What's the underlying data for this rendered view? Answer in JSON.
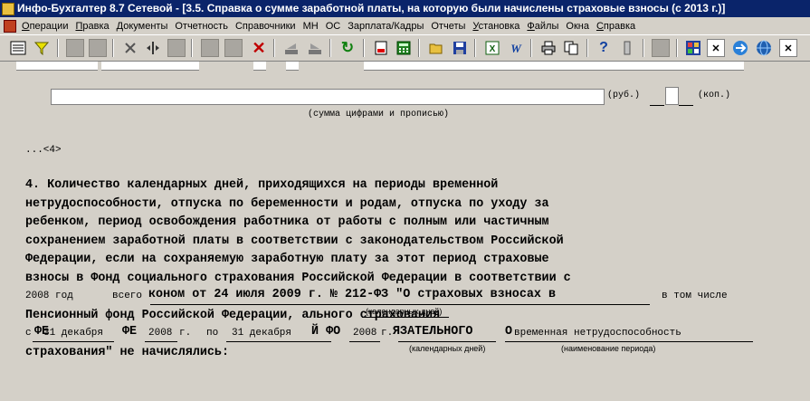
{
  "window": {
    "title": "Инфо-Бухгалтер 8.7 Сетевой - [3.5.  Справка о сумме заработной платы, на которую были начислены страховые взносы (с 2013 г.)]"
  },
  "menu": {
    "items": [
      {
        "hot": "О",
        "rest": "перации"
      },
      {
        "hot": "П",
        "rest": "равка"
      },
      {
        "hot": "Д",
        "rest": "окументы"
      },
      {
        "hot": "",
        "rest": "Отчетность"
      },
      {
        "hot": "",
        "rest": "Справочники"
      },
      {
        "hot": "",
        "rest": "МН"
      },
      {
        "hot": "",
        "rest": "ОС"
      },
      {
        "hot": "",
        "rest": "Зарплата/Кадры"
      },
      {
        "hot": "",
        "rest": "Отчеты"
      },
      {
        "hot": "У",
        "rest": "становка"
      },
      {
        "hot": "Ф",
        "rest": "айлы"
      },
      {
        "hot": "",
        "rest": "Окна"
      },
      {
        "hot": "С",
        "rest": "правка"
      }
    ]
  },
  "toolbar": {
    "icons": [
      "list-icon",
      "filter-icon",
      "blank-icon",
      "blank-icon",
      "cut-icon",
      "split-icon",
      "copy-icon",
      "blank-icon",
      "blank-icon",
      "delete-icon",
      "move-icon",
      "move-icon",
      "refresh-icon",
      "document-icon",
      "calculator-icon",
      "open-folder-icon",
      "save-icon",
      "excel-icon",
      "word-icon",
      "print-icon",
      "copy-icon",
      "help-icon",
      "info-icon",
      "blank-icon",
      "app-icon",
      "close-icon",
      "remote-icon",
      "globe-icon",
      "close-icon"
    ]
  },
  "form": {
    "rub_label": "(руб.)",
    "kop_label": "(коп.)",
    "sum_caption": "(сумма цифрами и прописью)",
    "note_ref": "...<4>",
    "paragraph_lines": [
      "4. Количество календарных дней, приходящихся на периоды временной",
      "нетрудоспособности, отпуска по беременности и родам, отпуска по уходу за",
      "ребенком, период освобождения работника от работы с полным или частичным",
      "сохранением заработной платы в соответствии с законодательством Российской",
      "Федерации, если на сохраняемую заработную плату за этот период страховые",
      "взносы в Фонд социального страхования Российской Федерации в соответствии с",
      "",
      "Пенсионный фонд Российской Федерации,       ального страхования",
      "",
      "страхования\" не начислялись:"
    ],
    "line7_bold": "коном от 24 июля 2009 г. № 212-ФЗ \"О страховых взносах в",
    "line7_year": "2008 год",
    "line7_total": "всего",
    "line7_including": "в том числе",
    "cal_days_1": "(календарных дней)",
    "line9_so": "с",
    "line9_from": "31 декабря",
    "line9_from_year": "2008",
    "line9_g": "г.",
    "line9_po": "по",
    "line9_to": "31 декабря",
    "line9_to_year": "2008",
    "line9_g2": "г.",
    "line9_bold_a": "ФЕ",
    "line9_bold_b": "ФЕ",
    "line9_bold_c": "Й ФО",
    "line9_bold_d": "ЯЗАТЕЛЬНОГО",
    "line9_bold_e": "О",
    "line9_period_name": "временная нетрудоспособность",
    "cal_days_2": "(календарных дней)",
    "period_caption": "(наименование периода)"
  }
}
